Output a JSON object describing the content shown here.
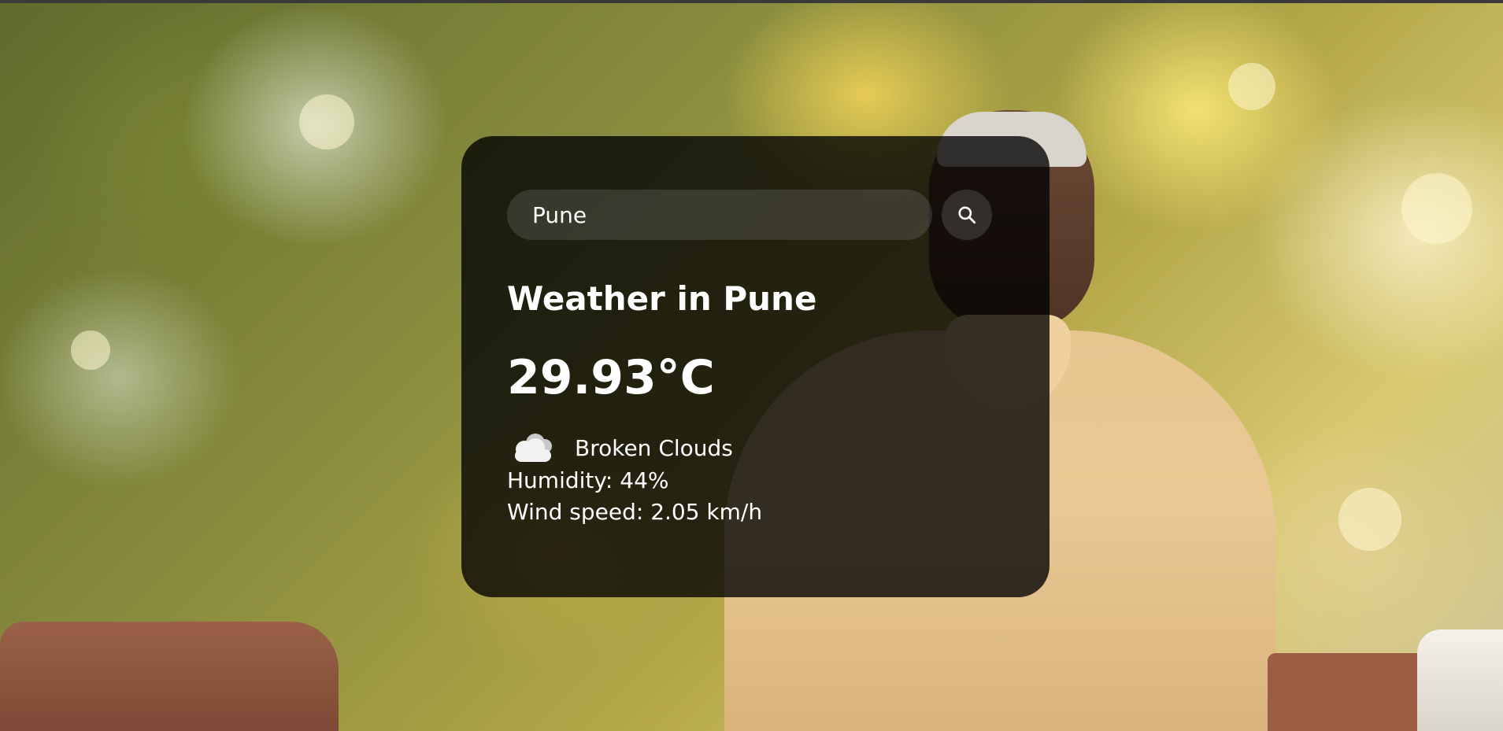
{
  "search": {
    "value": "Pune"
  },
  "weather": {
    "title": "Weather in Pune",
    "temperature": "29.93°C",
    "description": "Broken Clouds",
    "humidity": "Humidity: 44%",
    "wind": "Wind speed: 2.05 km/h",
    "condition_icon": "cloud-icon"
  },
  "icons": {
    "search_button": "search-icon"
  },
  "colors": {
    "card_background": "#000000",
    "text": "#ffffff"
  }
}
